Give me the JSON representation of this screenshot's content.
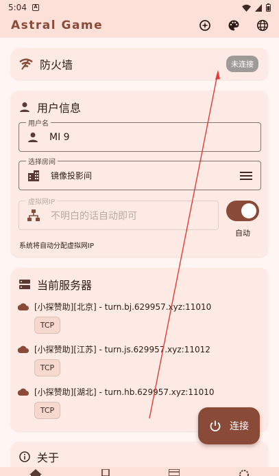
{
  "status_bar": {
    "time": "5:04",
    "notification_letter": "A"
  },
  "app_bar": {
    "title": "Astral Game"
  },
  "firewall_card": {
    "title": "防火墙",
    "status": "未连接"
  },
  "user_card": {
    "title": "用户信息",
    "username": {
      "label": "用户名",
      "value": "MI 9"
    },
    "room": {
      "label": "选择房间",
      "value": "镜像投影间"
    },
    "virtual_ip": {
      "label": "虚拟网IP",
      "placeholder": "不明白的话自动即可"
    },
    "auto_toggle": {
      "label": "自动",
      "on": true
    },
    "hint": "系统将自动分配虚拟网IP"
  },
  "servers_card": {
    "title": "当前服务器",
    "servers": [
      {
        "name": "[小探赞助][北京] - turn.bj.629957.xyz:11010",
        "protocol": "TCP"
      },
      {
        "name": "[小探赞助][江苏] - turn.js.629957.xyz:11012",
        "protocol": "TCP"
      },
      {
        "name": "[小探赞助][湖北] - turn.hb.629957.xyz:11010",
        "protocol": "TCP"
      }
    ]
  },
  "about_card": {
    "title": "关于"
  },
  "fab": {
    "label": "连接"
  },
  "colors": {
    "accent": "#8a4a38",
    "surface": "#fdeae4",
    "background": "#fff5f2",
    "annotation": "#e53935"
  }
}
